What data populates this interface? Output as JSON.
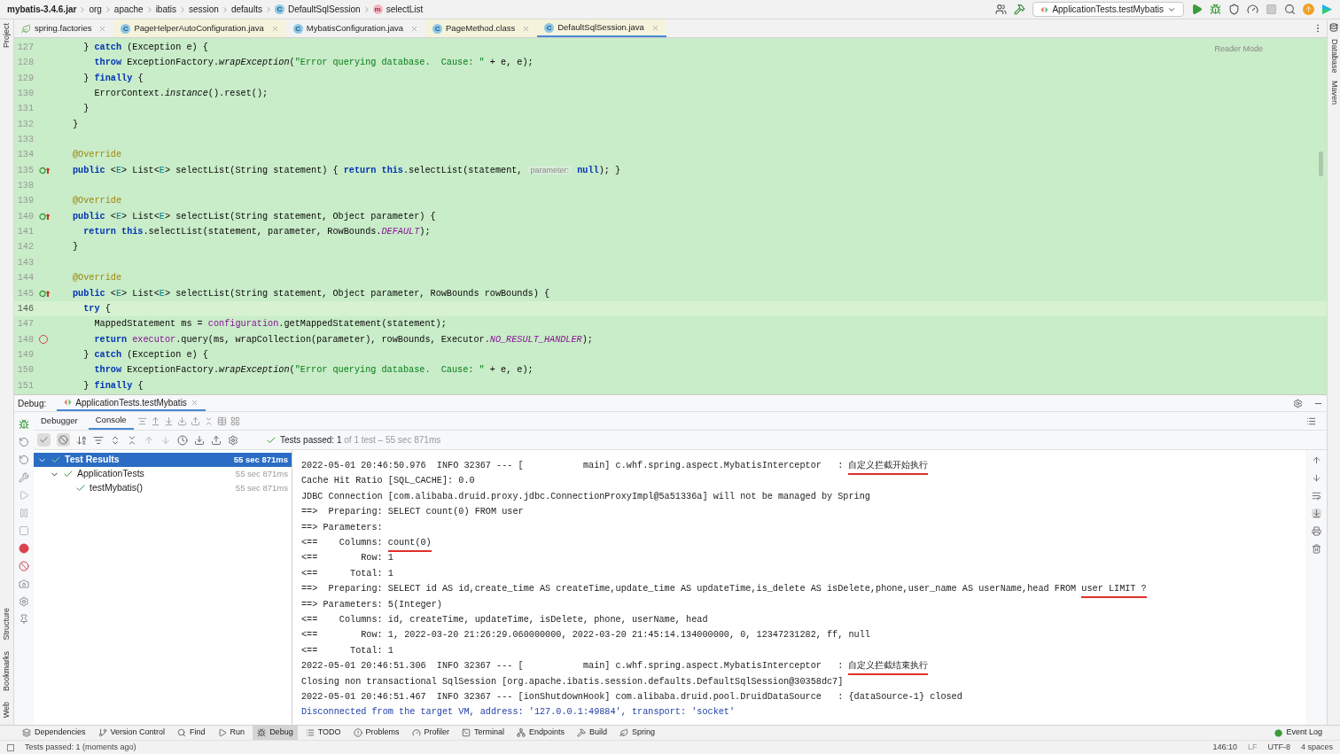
{
  "breadcrumbs": [
    {
      "text": "mybatis-3.4.6.jar",
      "kind": "root"
    },
    {
      "text": "org",
      "kind": "package"
    },
    {
      "text": "apache",
      "kind": "package"
    },
    {
      "text": "ibatis",
      "kind": "package"
    },
    {
      "text": "session",
      "kind": "package"
    },
    {
      "text": "defaults",
      "kind": "package"
    },
    {
      "text": "DefaultSqlSession",
      "kind": "class",
      "icon_letter": "C"
    },
    {
      "text": "selectList",
      "kind": "method",
      "icon_letter": "m"
    }
  ],
  "run_config": "ApplicationTests.testMybatis",
  "tabs": [
    {
      "label": "spring.factories",
      "kind": "spring",
      "library": false,
      "selected": false
    },
    {
      "label": "PageHelperAutoConfiguration.java",
      "kind": "class",
      "icon_letter": "C",
      "library": true,
      "selected": false
    },
    {
      "label": "MybatisConfiguration.java",
      "kind": "class",
      "icon_letter": "C",
      "library": false,
      "selected": false
    },
    {
      "label": "PageMethod.class",
      "kind": "class",
      "icon_letter": "C",
      "library": true,
      "selected": false
    },
    {
      "label": "DefaultSqlSession.java",
      "kind": "class",
      "icon_letter": "C",
      "library": true,
      "selected": true
    }
  ],
  "left_tool_tabs": {
    "top": [
      "Project"
    ],
    "bottom": [
      "Structure",
      "Bookmarks",
      "Web"
    ]
  },
  "right_tool_tabs": [
    "Database",
    "Maven"
  ],
  "reader_mode": "Reader Mode",
  "code_lines": [
    {
      "number": "127",
      "kind": "code",
      "current": false,
      "segments": [
        {
          "kind": "plain",
          "text": "  } "
        },
        {
          "kind": "keyword",
          "text": "catch"
        },
        {
          "kind": "plain",
          "text": " (Exception e) {"
        }
      ]
    },
    {
      "number": "128",
      "kind": "code",
      "current": false,
      "segments": [
        {
          "kind": "keyword",
          "text": "    throw"
        },
        {
          "kind": "plain",
          "text": " ExceptionFactory."
        },
        {
          "kind": "static_call",
          "text": "wrapException"
        },
        {
          "kind": "plain",
          "text": "("
        },
        {
          "kind": "string",
          "text": "\"Error querying database.  Cause: \""
        },
        {
          "kind": "plain",
          "text": " + e, e);"
        }
      ]
    },
    {
      "number": "129",
      "kind": "code",
      "current": false,
      "segments": [
        {
          "kind": "plain",
          "text": "  } "
        },
        {
          "kind": "keyword",
          "text": "finally"
        },
        {
          "kind": "plain",
          "text": " {"
        }
      ]
    },
    {
      "number": "130",
      "kind": "code",
      "current": false,
      "segments": [
        {
          "kind": "plain",
          "text": "    ErrorContext."
        },
        {
          "kind": "static_call",
          "text": "instance"
        },
        {
          "kind": "plain",
          "text": "().reset();"
        }
      ]
    },
    {
      "number": "131",
      "kind": "code",
      "current": false,
      "segments": [
        {
          "kind": "plain",
          "text": "  }"
        }
      ]
    },
    {
      "number": "132",
      "kind": "code",
      "current": false,
      "segments": [
        {
          "kind": "plain",
          "text": "}"
        }
      ]
    },
    {
      "number": "133",
      "kind": "code",
      "current": false
    },
    {
      "number": "134",
      "kind": "code",
      "current": false,
      "segments": [
        {
          "kind": "annotation",
          "text": "@Override"
        }
      ]
    },
    {
      "number": "135",
      "kind": "override",
      "current": false,
      "segments": [
        {
          "kind": "keyword",
          "text": "public"
        },
        {
          "kind": "plain",
          "text": " <"
        },
        {
          "kind": "type_param",
          "text": "E"
        },
        {
          "kind": "plain",
          "text": "> List<"
        },
        {
          "kind": "type_param",
          "text": "E"
        },
        {
          "kind": "plain",
          "text": "> selectList(String statement) { "
        },
        {
          "kind": "keyword",
          "text": "return this"
        },
        {
          "kind": "plain",
          "text": ".selectList(statement, "
        },
        {
          "kind": "hint",
          "text": "parameter:"
        },
        {
          "kind": "keyword",
          "text": " null"
        },
        {
          "kind": "plain",
          "text": "); }"
        }
      ]
    },
    {
      "number": "138",
      "kind": "code",
      "current": false
    },
    {
      "number": "139",
      "kind": "code",
      "current": false,
      "segments": [
        {
          "kind": "annotation",
          "text": "@Override"
        }
      ]
    },
    {
      "number": "140",
      "kind": "override",
      "current": false,
      "segments": [
        {
          "kind": "keyword",
          "text": "public"
        },
        {
          "kind": "plain",
          "text": " <"
        },
        {
          "kind": "type_param",
          "text": "E"
        },
        {
          "kind": "plain",
          "text": "> List<"
        },
        {
          "kind": "type_param",
          "text": "E"
        },
        {
          "kind": "plain",
          "text": "> selectList(String statement, Object parameter) {"
        }
      ]
    },
    {
      "number": "141",
      "kind": "code",
      "current": false,
      "segments": [
        {
          "kind": "keyword",
          "text": "  return this"
        },
        {
          "kind": "plain",
          "text": ".selectList(statement, parameter, RowBounds."
        },
        {
          "kind": "static_field",
          "text": "DEFAULT"
        },
        {
          "kind": "plain",
          "text": ");"
        }
      ]
    },
    {
      "number": "142",
      "kind": "code",
      "current": false,
      "segments": [
        {
          "kind": "plain",
          "text": "}"
        }
      ]
    },
    {
      "number": "143",
      "kind": "code",
      "current": false
    },
    {
      "number": "144",
      "kind": "code",
      "current": false,
      "segments": [
        {
          "kind": "annotation",
          "text": "@Override"
        }
      ]
    },
    {
      "number": "145",
      "kind": "override",
      "current": false,
      "segments": [
        {
          "kind": "keyword",
          "text": "public"
        },
        {
          "kind": "plain",
          "text": " <"
        },
        {
          "kind": "type_param",
          "text": "E"
        },
        {
          "kind": "plain",
          "text": "> List<"
        },
        {
          "kind": "type_param",
          "text": "E"
        },
        {
          "kind": "plain",
          "text": "> selectList(String statement, Object parameter, RowBounds rowBounds) {"
        }
      ]
    },
    {
      "number": "146",
      "kind": "code",
      "current": true,
      "segments": [
        {
          "kind": "keyword",
          "text": "  try"
        },
        {
          "kind": "plain",
          "text": " {"
        }
      ]
    },
    {
      "number": "147",
      "kind": "code",
      "current": false,
      "segments": [
        {
          "kind": "plain",
          "text": "    MappedStatement ms = "
        },
        {
          "kind": "field",
          "text": "configuration"
        },
        {
          "kind": "plain",
          "text": ".getMappedStatement(statement);"
        }
      ]
    },
    {
      "number": "148",
      "kind": "breakpoint",
      "current": false,
      "segments": [
        {
          "kind": "keyword",
          "text": "    return"
        },
        {
          "kind": "field",
          "text": " executor"
        },
        {
          "kind": "plain",
          "text": ".query(ms, wrapCollection(parameter), rowBounds, Executor."
        },
        {
          "kind": "static_field",
          "text": "NO_RESULT_HANDLER"
        },
        {
          "kind": "plain",
          "text": ");"
        }
      ]
    },
    {
      "number": "149",
      "kind": "code",
      "current": false,
      "segments": [
        {
          "kind": "plain",
          "text": "  } "
        },
        {
          "kind": "keyword",
          "text": "catch"
        },
        {
          "kind": "plain",
          "text": " (Exception e) {"
        }
      ]
    },
    {
      "number": "150",
      "kind": "code",
      "current": false,
      "segments": [
        {
          "kind": "keyword",
          "text": "    throw"
        },
        {
          "kind": "plain",
          "text": " ExceptionFactory."
        },
        {
          "kind": "static_call",
          "text": "wrapException"
        },
        {
          "kind": "plain",
          "text": "("
        },
        {
          "kind": "string",
          "text": "\"Error querying database.  Cause: \""
        },
        {
          "kind": "plain",
          "text": " + e, e);"
        }
      ]
    },
    {
      "number": "151",
      "kind": "code",
      "current": false,
      "segments": [
        {
          "kind": "plain",
          "text": "  } "
        },
        {
          "kind": "keyword",
          "text": "finally"
        },
        {
          "kind": "plain",
          "text": " {"
        }
      ]
    }
  ],
  "debug": {
    "label": "Debug:",
    "session_tab": "ApplicationTests.testMybatis",
    "tabs": [
      {
        "label": "Debugger",
        "selected": false
      },
      {
        "label": "Console",
        "selected": true
      }
    ],
    "summary": {
      "bold": "Tests passed: 1",
      "rest": "of 1 test – 55 sec 871ms"
    },
    "tree": [
      {
        "label": "Test Results",
        "time": "55 sec 871ms",
        "selected": true,
        "expanded": true,
        "children": [
          {
            "label": "ApplicationTests",
            "time": "55 sec 871ms",
            "selected": false,
            "expanded": true,
            "children": [
              {
                "label": "testMybatis()",
                "time": "55 sec 871ms",
                "selected": false
              }
            ]
          }
        ]
      }
    ],
    "console": [
      {
        "kind": "log",
        "segments": [
          {
            "text": "2022-05-01 20:46:50.976  INFO 32367 --- [           main] c.whf.spring.aspect.MybatisInterceptor   : ",
            "underlined": false
          },
          {
            "text": "自定义拦截开始执行",
            "underlined": true
          }
        ]
      },
      {
        "kind": "log",
        "segments": [
          {
            "text": "Cache Hit Ratio [SQL_CACHE]: 0.0",
            "underlined": false
          }
        ]
      },
      {
        "kind": "log",
        "segments": [
          {
            "text": "JDBC Connection [com.alibaba.druid.proxy.jdbc.ConnectionProxyImpl@5a51336a] will not be managed by Spring",
            "underlined": false
          }
        ]
      },
      {
        "kind": "log",
        "segments": [
          {
            "text": "==>  Preparing: SELECT count(0) FROM user",
            "underlined": false
          }
        ]
      },
      {
        "kind": "log",
        "segments": [
          {
            "text": "==> Parameters:",
            "underlined": false
          }
        ]
      },
      {
        "kind": "log",
        "segments": [
          {
            "text": "<==    Columns: ",
            "underlined": false
          },
          {
            "text": "count(0)",
            "underlined": true
          }
        ]
      },
      {
        "kind": "log",
        "segments": [
          {
            "text": "<==        Row: 1",
            "underlined": false
          }
        ]
      },
      {
        "kind": "log",
        "segments": [
          {
            "text": "<==      Total: 1",
            "underlined": false
          }
        ]
      },
      {
        "kind": "log",
        "segments": [
          {
            "text": "==>  Preparing: SELECT id AS id,create_time AS createTime,update_time AS updateTime,is_delete AS isDelete,phone,user_name AS userName,head FROM ",
            "underlined": false
          },
          {
            "text": "user LIMIT ?",
            "underlined": true
          }
        ]
      },
      {
        "kind": "log",
        "segments": [
          {
            "text": "==> Parameters: 5(Integer)",
            "underlined": false
          }
        ]
      },
      {
        "kind": "log",
        "segments": [
          {
            "text": "<==    Columns: id, createTime, updateTime, isDelete, phone, userName, head",
            "underlined": false
          }
        ]
      },
      {
        "kind": "log",
        "segments": [
          {
            "text": "<==        Row: 1, 2022-03-20 21:26:29.060000000, 2022-03-20 21:45:14.134000000, 0, 12347231282, ff, null",
            "underlined": false
          }
        ]
      },
      {
        "kind": "log",
        "segments": [
          {
            "text": "<==      Total: 1",
            "underlined": false
          }
        ]
      },
      {
        "kind": "log",
        "segments": [
          {
            "text": "2022-05-01 20:46:51.306  INFO 32367 --- [           main] c.whf.spring.aspect.MybatisInterceptor   : ",
            "underlined": false
          },
          {
            "text": "自定义拦截结束执行",
            "underlined": true
          }
        ]
      },
      {
        "kind": "log",
        "segments": [
          {
            "text": "Closing non transactional SqlSession [org.apache.ibatis.session.defaults.DefaultSqlSession@30358dc7]",
            "underlined": false
          }
        ]
      },
      {
        "kind": "log",
        "segments": [
          {
            "text": "2022-05-01 20:46:51.467  INFO 32367 --- [ionShutdownHook] com.alibaba.druid.pool.DruidDataSource   : {dataSource-1} closed",
            "underlined": false
          }
        ]
      },
      {
        "kind": "system",
        "segments": [
          {
            "text": "Disconnected from the target VM, address: '127.0.0.1:49884', transport: 'socket'",
            "underlined": false
          }
        ]
      }
    ]
  },
  "tool_bar": [
    {
      "label": "Dependencies",
      "selected": false
    },
    {
      "label": "Version Control",
      "selected": false
    },
    {
      "label": "Find",
      "selected": false
    },
    {
      "label": "Run",
      "selected": false
    },
    {
      "label": "Debug",
      "selected": true
    },
    {
      "label": "TODO",
      "selected": false
    },
    {
      "label": "Problems",
      "selected": false
    },
    {
      "label": "Profiler",
      "selected": false
    },
    {
      "label": "Terminal",
      "selected": false
    },
    {
      "label": "Endpoints",
      "selected": false
    },
    {
      "label": "Build",
      "selected": false
    },
    {
      "label": "Spring",
      "selected": false
    }
  ],
  "event_log": "Event Log",
  "status_bar": {
    "message": "Tests passed: 1 (moments ago)",
    "position": "146:10",
    "line_separator": "LF",
    "encoding": "UTF-8",
    "indent": "4 spaces"
  }
}
